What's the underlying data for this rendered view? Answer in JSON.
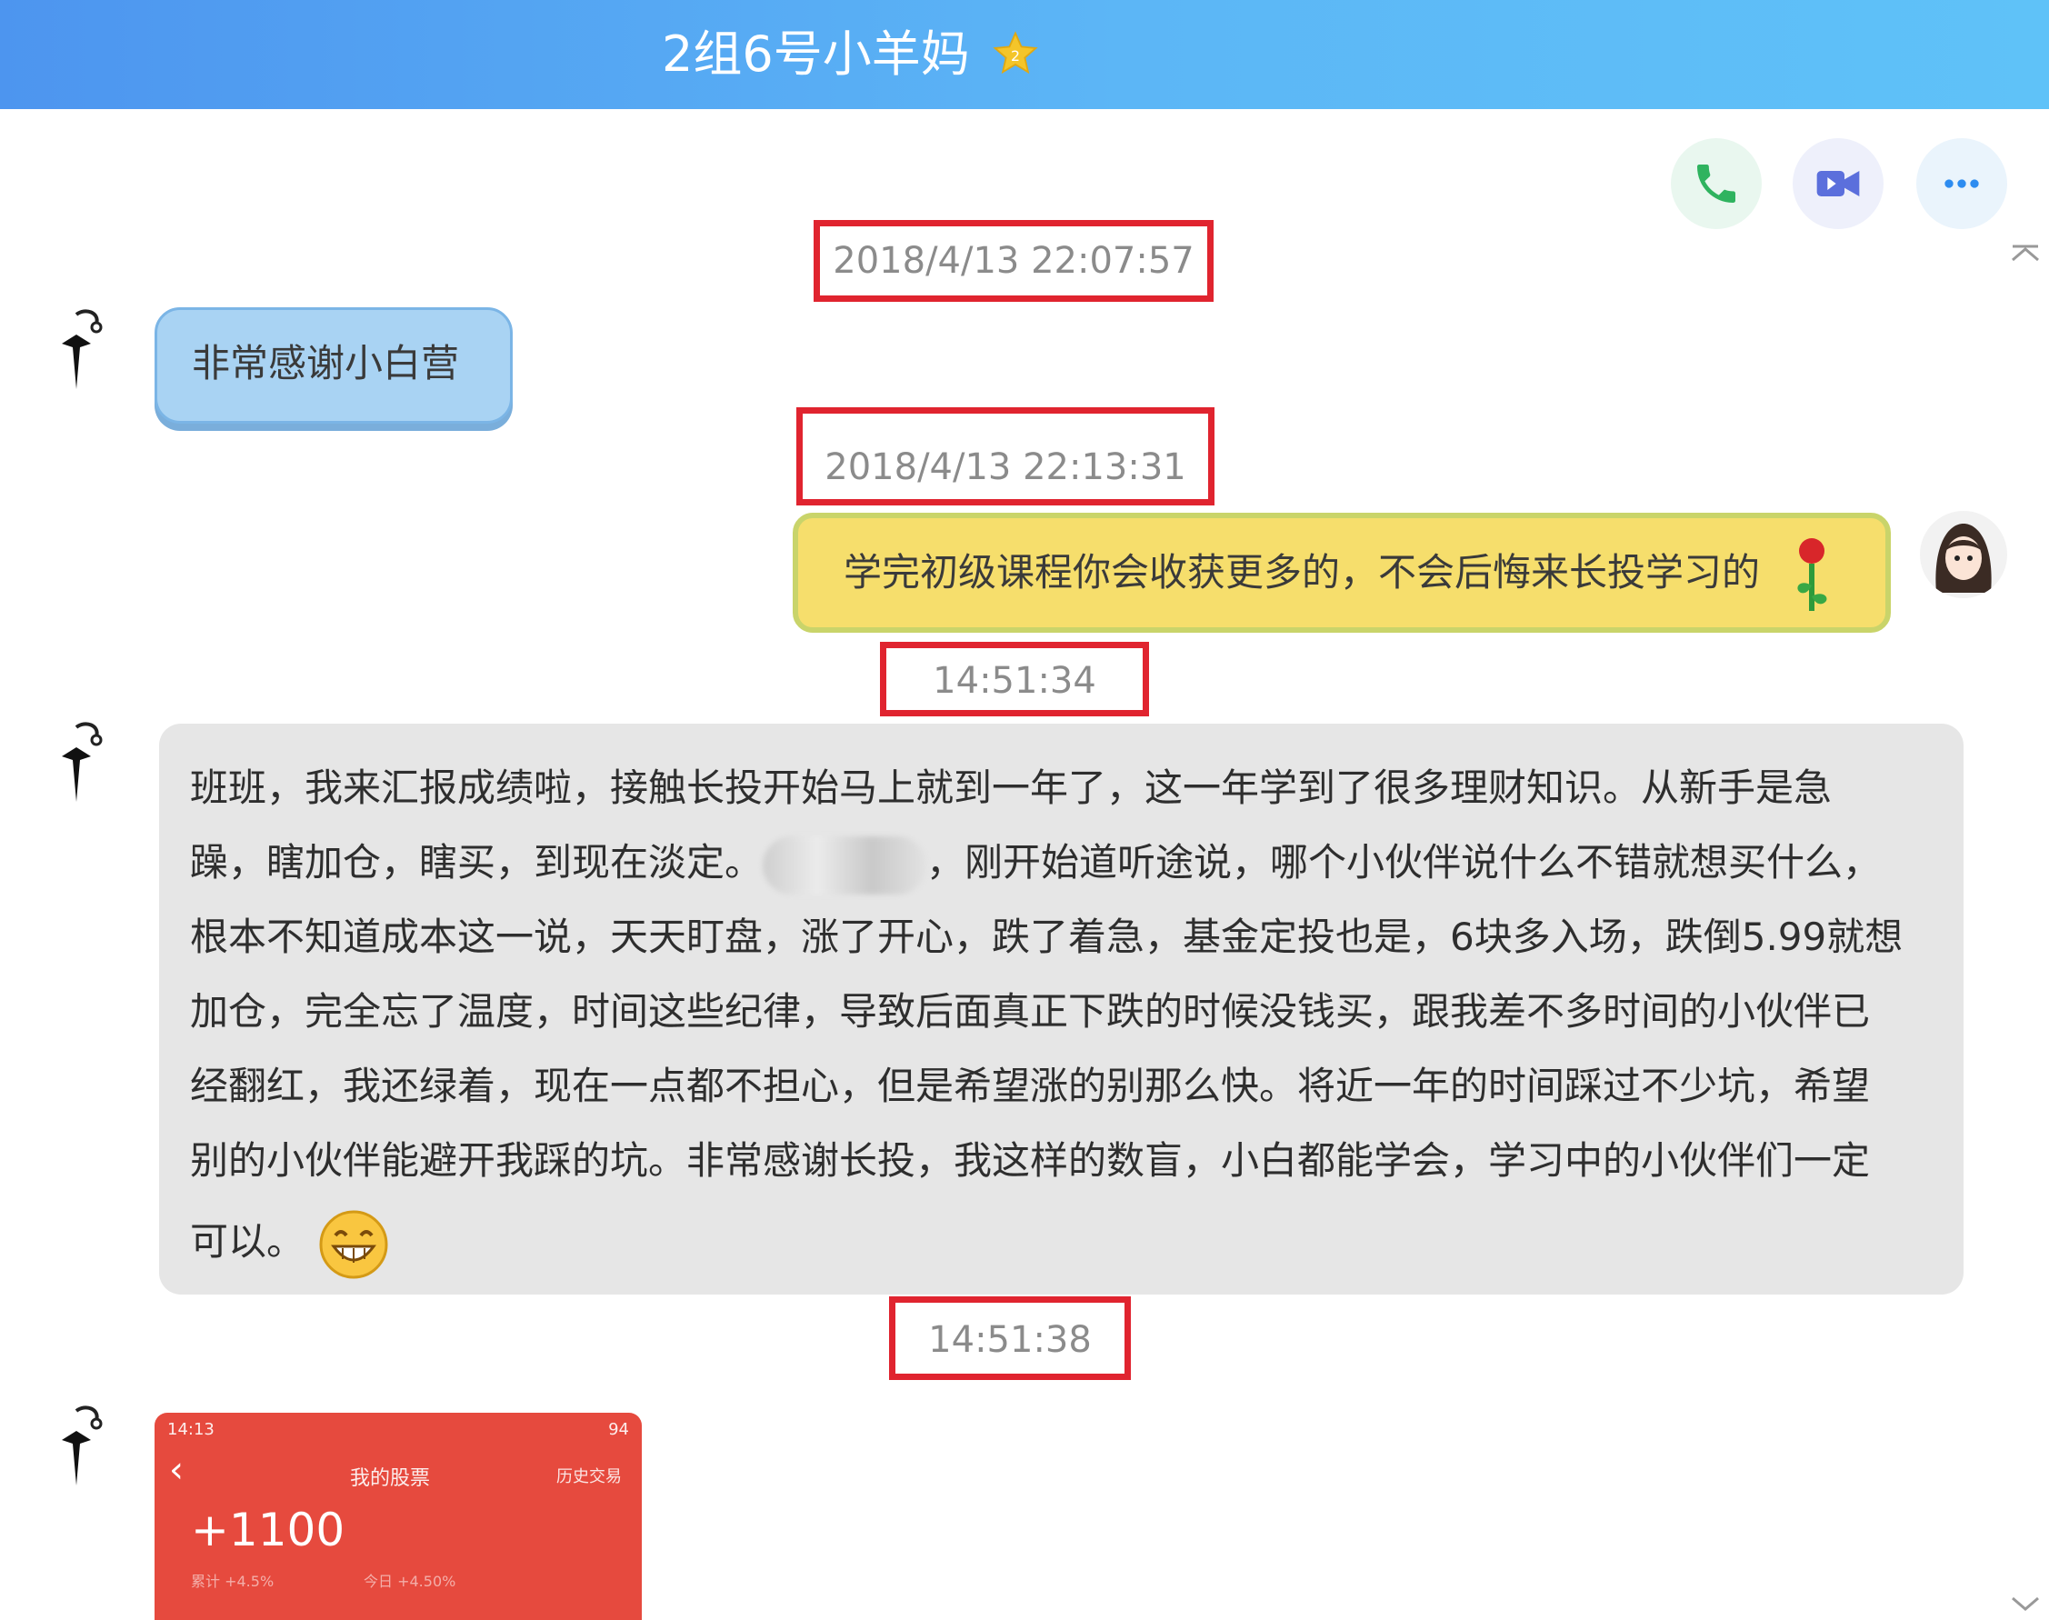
{
  "window": {
    "title": "2组6号小羊妈"
  },
  "toolbar": {
    "buttons": [
      "phone-icon",
      "video-icon",
      "more-icon"
    ]
  },
  "messages": [
    {
      "timestamp": "2018/4/13 22:07:57",
      "sender": "other",
      "text": "非常感谢小白营"
    },
    {
      "timestamp": "2018/4/13 22:13:31",
      "sender": "self",
      "text": "学完初级课程你会收获更多的，不会后悔来长投学习的"
    },
    {
      "timestamp": "14:51:34",
      "sender": "other",
      "lines": [
        "班班，我来汇报成绩啦，接触长投开始马上就到一年了，这一年学到了很多理财知识。从新手是急",
        "躁，瞎加仓，瞎买，到现在淡定。",
        "，刚开始道听途说，哪个小伙伴说什么不错就想买什么，",
        "根本不知道成本这一说，天天盯盘，涨了开心，跌了着急，基金定投也是，6块多入场，跌倒5.99就想",
        "加仓，完全忘了温度，时间这些纪律，导致后面真正下跌的时候没钱买，跟我差不多时间的小伙伴已",
        "经翻红，我还绿着，现在一点都不担心，但是希望涨的别那么快。将近一年的时间踩过不少坑，希望",
        "别的小伙伴能避开我踩的坑。非常感谢长投，我这样的数盲，小白都能学会，学习中的小伙伴们一定",
        "可以。"
      ]
    },
    {
      "timestamp": "14:51:38",
      "sender": "other",
      "image": {
        "status_time": "14:13",
        "status_right": "94",
        "screen_title": "我的股票",
        "screen_action": "历史交易",
        "value": "+1100",
        "sub_left": "累计 +4.5%",
        "sub_right": "今日 +4.50%"
      }
    }
  ],
  "colors": {
    "accent_red": "#e0242f",
    "title_blue": "#4d95ef"
  }
}
